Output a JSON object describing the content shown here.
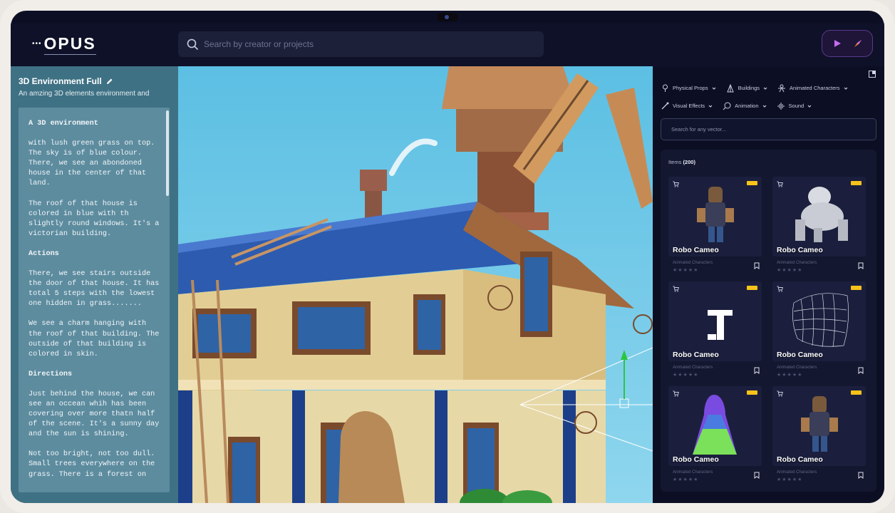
{
  "app": {
    "name": "OPUS",
    "logo_dots": "•••"
  },
  "search": {
    "placeholder": "Search by creator or projects"
  },
  "project": {
    "title": "3D Environment Full",
    "description": "An amzing 3D elements environment and",
    "prompt": [
      {
        "heading": true,
        "text": "A 3D environment"
      },
      {
        "heading": false,
        "text": "with lush green grass on top. The sky is of blue colour. There, we see an abondoned house in the center of that land."
      },
      {
        "heading": false,
        "text": "The roof of that house is colored in blue with th slightly round windows. It's a victorian building."
      },
      {
        "heading": true,
        "text": "Actions"
      },
      {
        "heading": false,
        "text": "There, we see stairs outside the door of that house. It has total 5 steps with the lowest one hidden in grass......."
      },
      {
        "heading": false,
        "text": "We see a charm hanging with the roof of that building. The outside of that building is colored in skin."
      },
      {
        "heading": true,
        "text": "Directions"
      },
      {
        "heading": false,
        "text": "Just behind the house, we can see an occean whih has been covering over more thatn half of the scene. It's a sunny day and the sun is shining."
      },
      {
        "heading": false,
        "text": "Not too bright, not too dull. Small trees everywhere on the grass. There is a forest on"
      }
    ]
  },
  "filters": {
    "row1": [
      {
        "label": "Physical Props",
        "icon": "lamp-icon"
      },
      {
        "label": "Buildings",
        "icon": "building-icon"
      },
      {
        "label": "Animated Characters",
        "icon": "character-icon"
      }
    ],
    "row2": [
      {
        "label": "Visual Effects",
        "icon": "wand-icon"
      },
      {
        "label": "Animation",
        "icon": "animation-icon"
      },
      {
        "label": "Sound",
        "icon": "sound-icon"
      }
    ]
  },
  "vector_search": {
    "placeholder": "Search for any vector..."
  },
  "items": {
    "label": "Items",
    "count": "(200)",
    "cards": [
      {
        "name": "Robo Cameo",
        "category": "Animated Characters",
        "stars": "★★★★★",
        "art": "robot-figure"
      },
      {
        "name": "Robo Cameo",
        "category": "Animated Characters",
        "stars": "★★★★★",
        "art": "robot-gorilla"
      },
      {
        "name": "Robo Cameo",
        "category": "Animated Characters",
        "stars": "★★★★★",
        "art": "letter-logo"
      },
      {
        "name": "Robo Cameo",
        "category": "Animated Characters",
        "stars": "★★★★★",
        "art": "wire-mesh"
      },
      {
        "name": "Robo Cameo",
        "category": "Animated Characters",
        "stars": "★★★★★",
        "art": "cloak-figure"
      },
      {
        "name": "Robo Cameo",
        "category": "Animated Characters",
        "stars": "★★★★★",
        "art": "robot-figure"
      }
    ]
  },
  "colors": {
    "accent": "#f7c31a",
    "play": "#c46bf0",
    "panel": "#3f7184",
    "sky": "#5cbfe3"
  }
}
